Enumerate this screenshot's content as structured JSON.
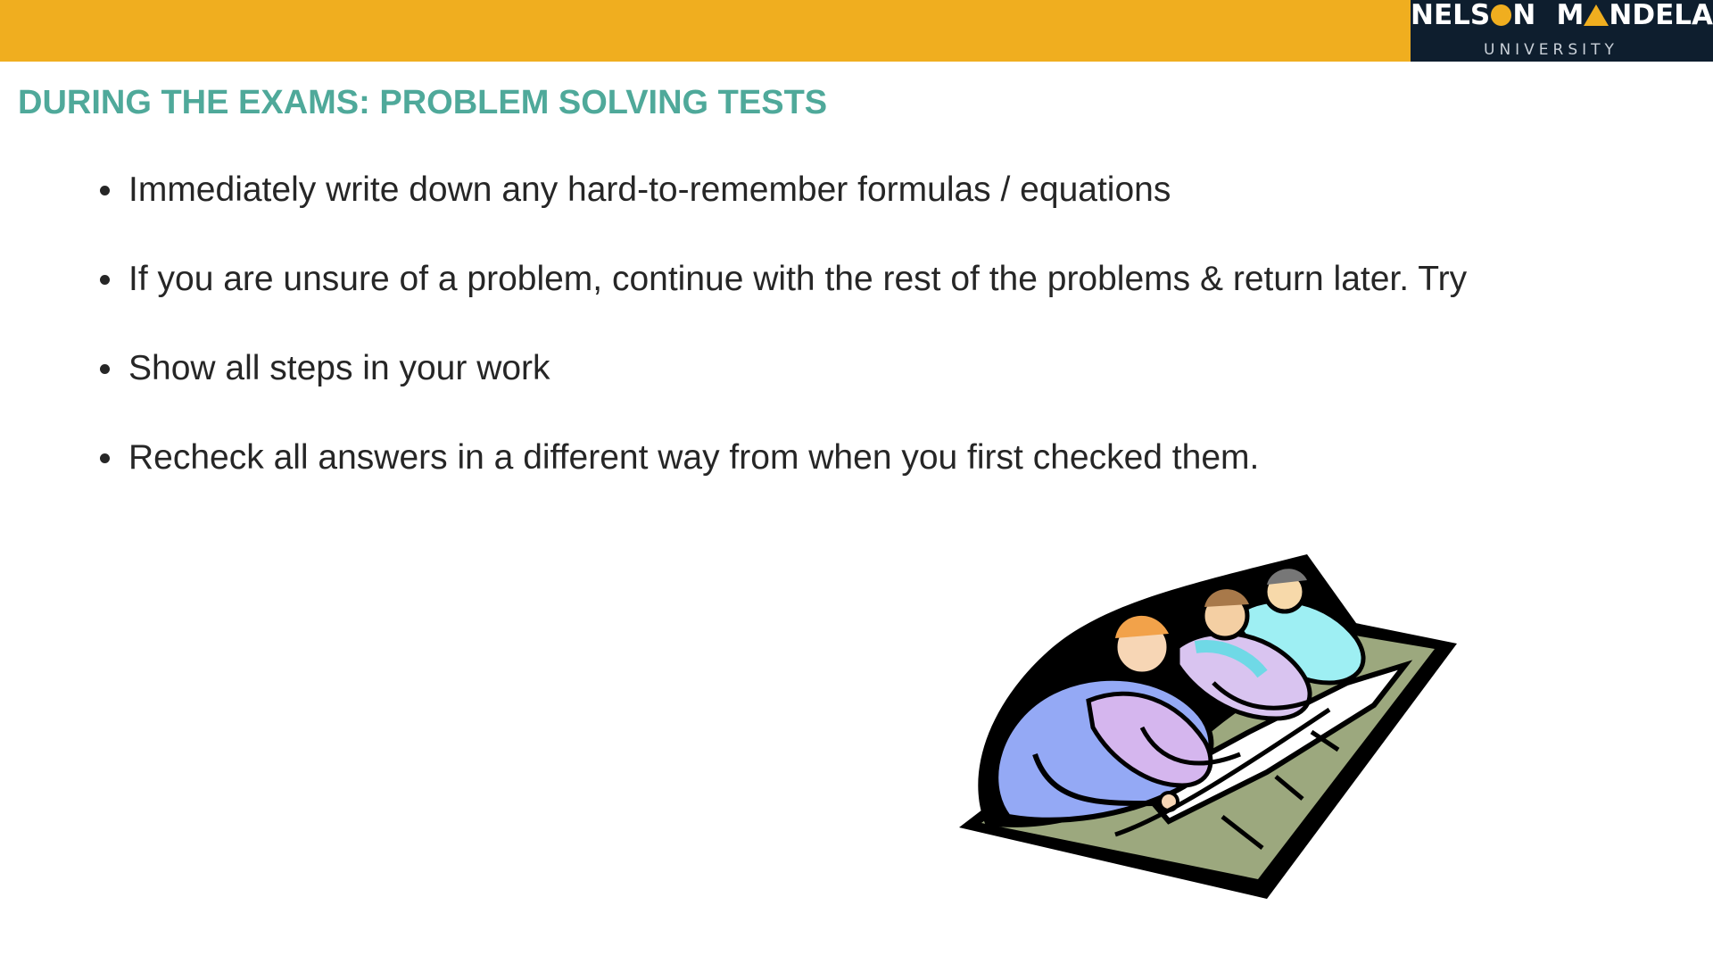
{
  "header": {
    "bar_color": "#F0AE1F",
    "logo": {
      "line1_part1": "NELS",
      "line1_part2": "N",
      "line1_part3": "M",
      "line1_part4": "NDELA",
      "line2": "UNIVERSITY",
      "background": "#0E1E2E",
      "accent": "#F0AE1F"
    }
  },
  "slide": {
    "title": "DURING THE EXAMS: PROBLEM SOLVING TESTS",
    "title_color": "#4FA99A",
    "bullets": [
      "Immediately write down any hard-to-remember formulas / equations",
      "If you are unsure of a problem, continue with the rest of the problems & return later. Try",
      "Show all steps in your work",
      "Recheck all answers in a different way from when you first checked them."
    ]
  },
  "illustration": {
    "icon": "students-writing-exam-clipart"
  }
}
